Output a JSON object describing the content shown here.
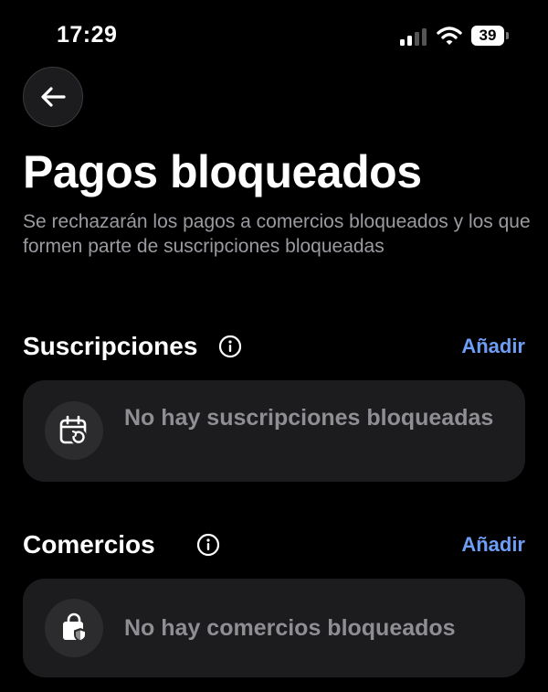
{
  "status_bar": {
    "time": "17:29",
    "battery": "39",
    "icons": [
      "signal-icon",
      "wifi-icon",
      "battery-icon"
    ]
  },
  "header": {
    "back_icon": "arrow-left-icon",
    "title": "Pagos bloqueados",
    "subtitle": "Se rechazarán los pagos a comercios bloqueados y los que formen parte de suscripciones bloqueadas"
  },
  "subscriptions": {
    "title": "Suscripciones",
    "info_icon": "info-icon",
    "add_label": "Añadir",
    "empty_icon": "calendar-refresh-icon",
    "empty_text": "No hay suscripciones bloqueadas"
  },
  "merchants": {
    "title": "Comercios",
    "info_icon": "info-icon",
    "add_label": "Añadir",
    "empty_icon": "shopping-bag-shield-icon",
    "empty_text": "No hay comercios bloqueados"
  },
  "colors": {
    "background": "#000000",
    "card": "#1c1c1e",
    "accent": "#6e9df5",
    "muted_text": "#8e8e93"
  }
}
